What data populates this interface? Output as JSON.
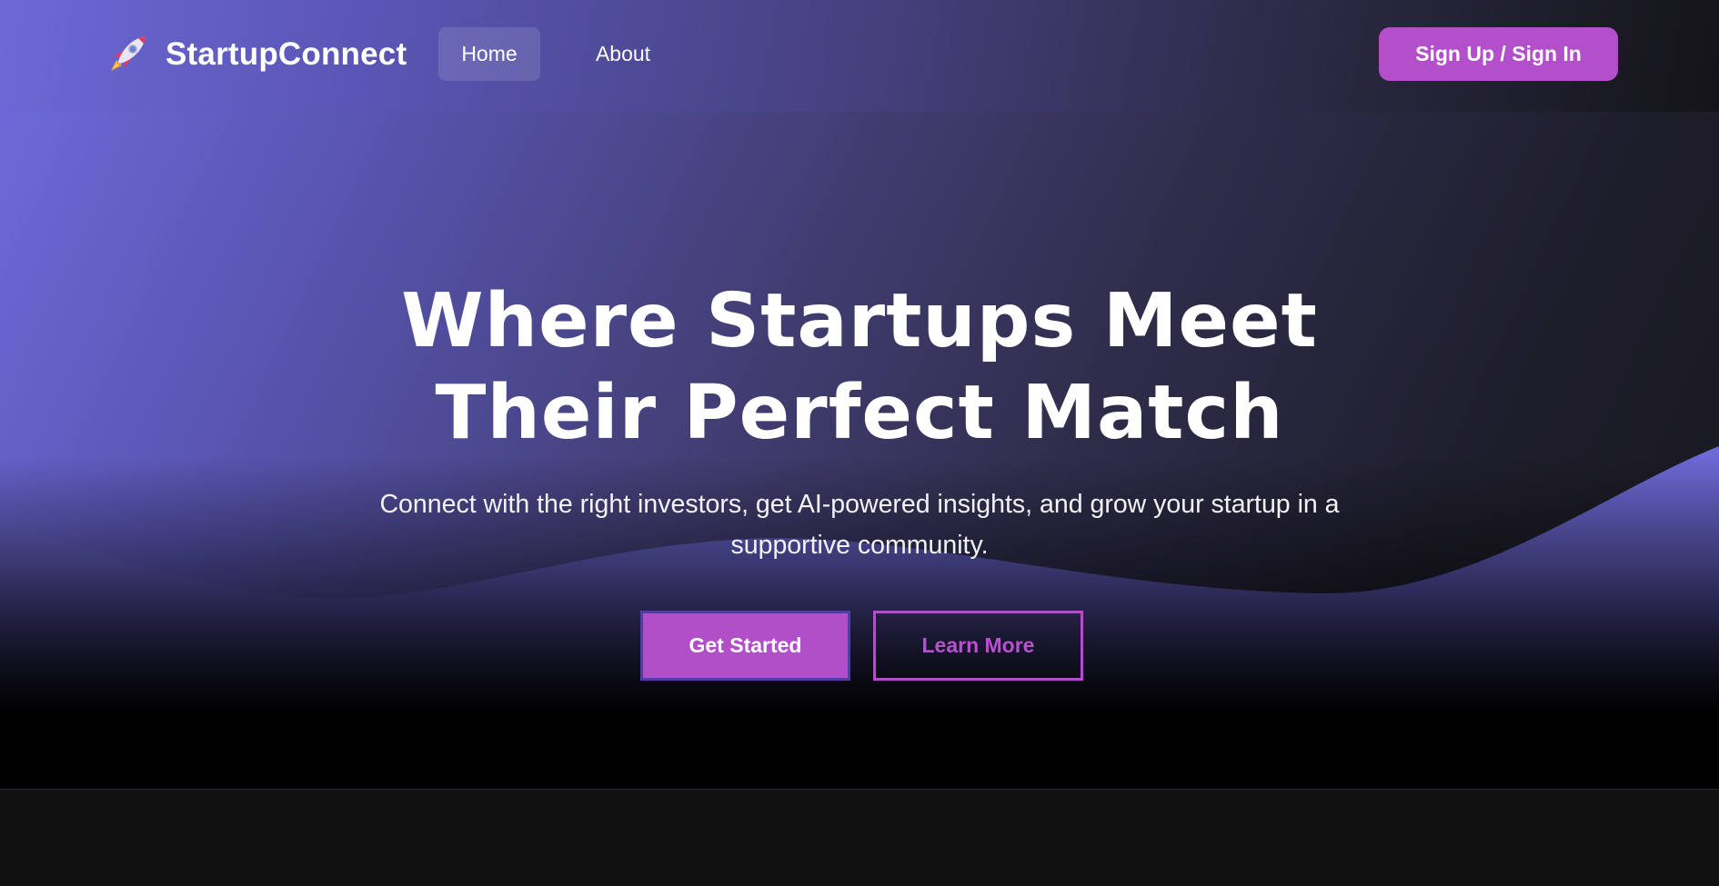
{
  "brand": {
    "name": "StartupConnect",
    "icon": "rocket-icon"
  },
  "nav": {
    "items": [
      {
        "label": "Home",
        "active": true
      },
      {
        "label": "About",
        "active": false
      }
    ],
    "signup_label": "Sign Up / Sign In"
  },
  "hero": {
    "title_line1": "Where Startups Meet",
    "title_line2": "Their Perfect Match",
    "subtitle_line1": "Connect with the right investors, get AI-powered insights, and grow your startup in a",
    "subtitle_line2": "supportive community.",
    "primary_cta": "Get Started",
    "secondary_cta": "Learn More"
  },
  "colors": {
    "accent": "#b04fc8",
    "gradient_start": "#6d69d8",
    "gradient_end": "#17171d",
    "page_background": "#111111"
  }
}
